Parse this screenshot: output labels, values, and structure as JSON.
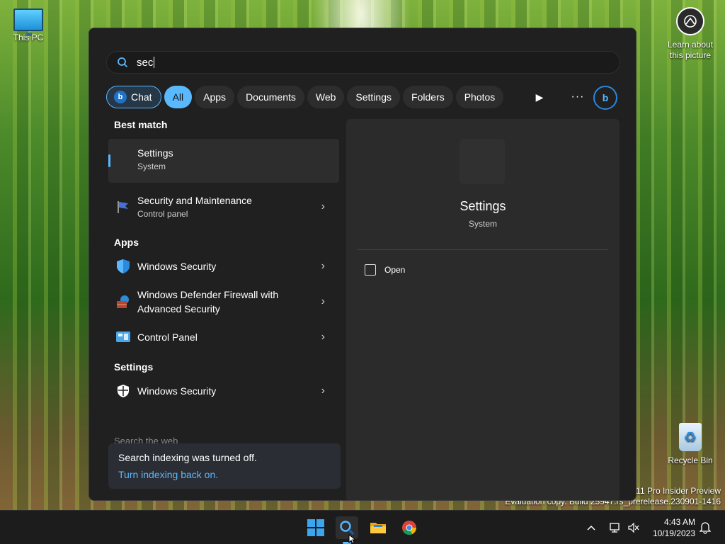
{
  "desktop": {
    "this_pc_label": "This PC",
    "learn_label": "Learn about this picture",
    "recycle_label": "Recycle Bin",
    "watermark_line1": "s 11 Pro Insider Preview",
    "watermark_line2": "Evaluation copy. Build 25947.rs_prerelease.230901-1416"
  },
  "search": {
    "query": "sec",
    "filters": [
      "Chat",
      "All",
      "Apps",
      "Documents",
      "Web",
      "Settings",
      "Folders",
      "Photos"
    ],
    "active_filter": "All"
  },
  "results": {
    "best_match_title": "Best match",
    "best_match": {
      "title": "Settings",
      "subtitle": "System"
    },
    "secmaint": {
      "title": "Security and Maintenance",
      "subtitle": "Control panel"
    },
    "apps_title": "Apps",
    "apps": [
      {
        "title": "Windows Security"
      },
      {
        "title_line1": "Windows Defender Firewall with",
        "title_line2": "Advanced Security"
      },
      {
        "title": "Control Panel"
      }
    ],
    "settings_title": "Settings",
    "settings": [
      {
        "title": "Windows Security"
      }
    ],
    "cutoff_text": "Search the web"
  },
  "notice": {
    "line1": "Search indexing was turned off.",
    "link": "Turn indexing back on."
  },
  "preview": {
    "title": "Settings",
    "subtitle": "System",
    "open_label": "Open"
  },
  "taskbar": {
    "time": "4:43 AM",
    "date": "10/19/2023"
  },
  "colors": {
    "accent": "#5ab8ff",
    "flyout_bg": "#202020"
  }
}
